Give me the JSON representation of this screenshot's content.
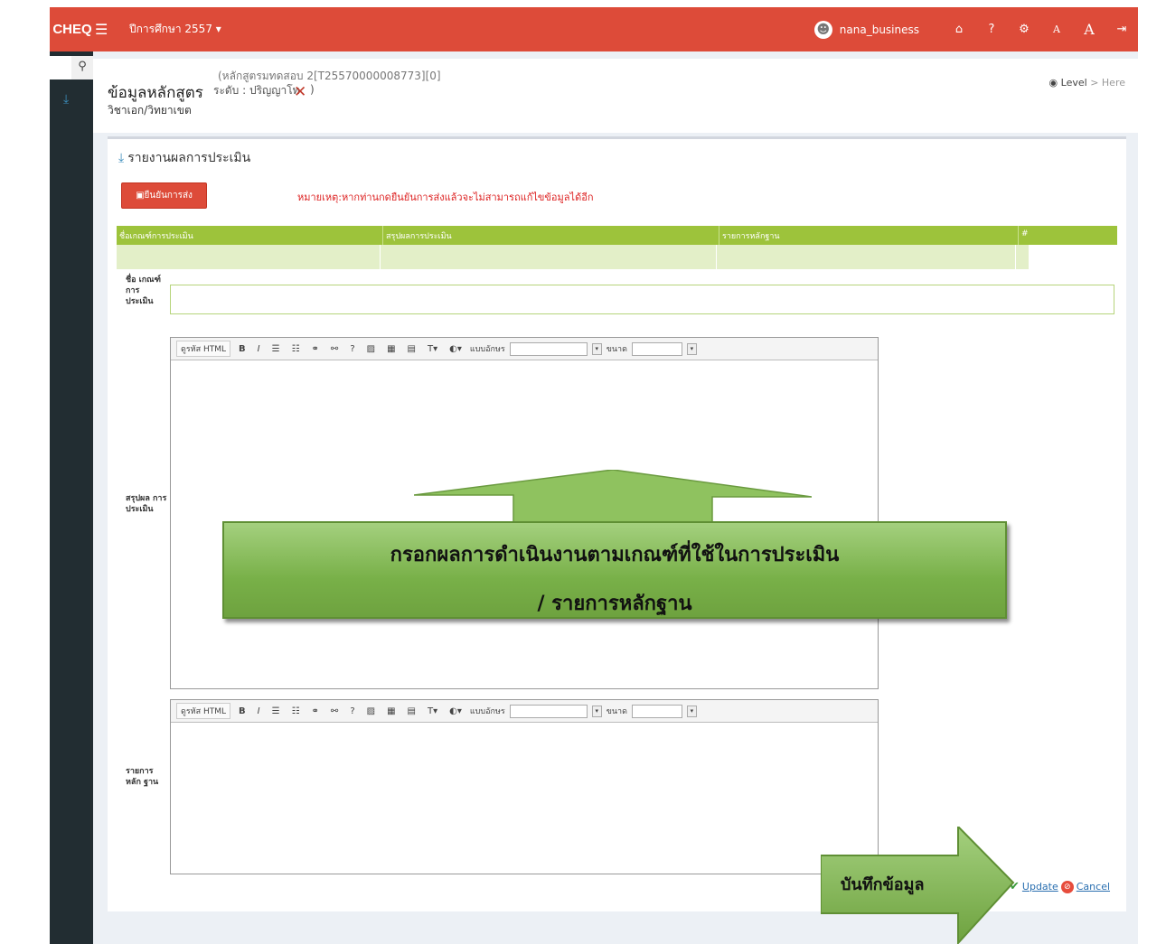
{
  "topbar": {
    "brand": "CHEQ",
    "menu_icon": "hamburger-icon",
    "year_label": "ปีการศึกษา 2557",
    "username": "nana_business",
    "icons": [
      "home-icon",
      "help-icon",
      "settings-icon",
      "font-small-icon",
      "font-large-icon",
      "logout-icon"
    ]
  },
  "sidebar": {
    "search_icon": "search-icon",
    "item_icon": "download-icon"
  },
  "header": {
    "title": "ข้อมูลหลักสูตร",
    "course_line": "(หลักสูตรมทดสอบ 2[T25570000008773][0]",
    "level_line": "ระดับ : ปริญญาโท",
    "close_paren": ")",
    "section": "วิชาเอก/วิทยาเขต",
    "breadcrumb_level": "Level",
    "breadcrumb_sep": ">",
    "breadcrumb_here": "Here"
  },
  "panel": {
    "title": "รายงานผลการประเมิน",
    "confirm_label": "ยืนยันการส่ง",
    "note": "หมายเหตุ:หากท่านกดยืนยันการส่งแล้วจะไม่สามารถแก้ไขข้อมูลได้อีก",
    "columns": [
      "ชื่อเกณฑ์การประเมิน",
      "สรุปผลการประเมิน",
      "รายการหลักฐาน",
      "#"
    ]
  },
  "form": {
    "label_name": "ชื่อ เกณฑ์ การ ประเมิน",
    "label_summary": "สรุปผล การ ประเมิน",
    "label_evidence": "รายการ หลัก ฐาน"
  },
  "editor_toolbar": {
    "source": "ดูรหัส HTML",
    "bold": "B",
    "italic": "I",
    "font_label": "แบบอักษร",
    "size_label": "ขนาด"
  },
  "overlay": {
    "line1": "กรอกผลการดำเนินงานตามเกณฑ์ที่ใช้ในการประเมิน",
    "line2": "/ รายการหลักฐาน",
    "save_hint": "บันทึกข้อมูล"
  },
  "actions": {
    "update": "Update",
    "cancel": "Cancel"
  },
  "colors": {
    "topbar": "#dd4b39",
    "sidebar": "#222d32",
    "table_header": "#9dc33b",
    "overlay_green": "#78b048"
  }
}
